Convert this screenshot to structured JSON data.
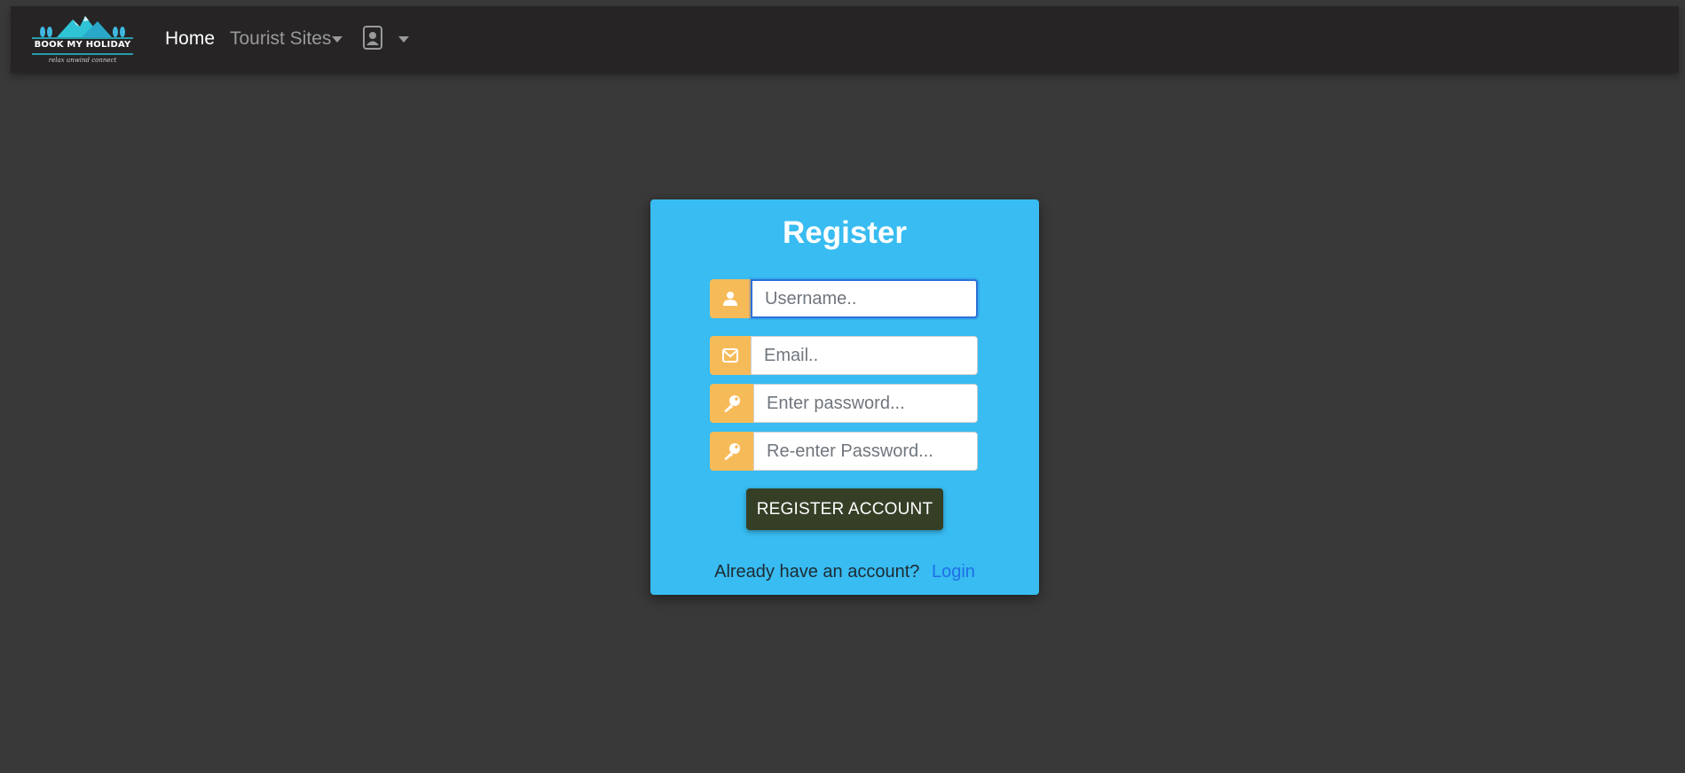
{
  "brand": {
    "logo_title": "BOOK MY HOLIDAY",
    "logo_tagline": "relax unwind connect",
    "colors": {
      "mountains": "#2ec4d6",
      "trees": "#3fb8e0"
    }
  },
  "nav": {
    "home": "Home",
    "tourist_sites": "Tourist Sites",
    "profile_icon": "contact-card-icon"
  },
  "form": {
    "title": "Register",
    "username": {
      "placeholder": "Username..",
      "value": "",
      "icon": "user-icon"
    },
    "email": {
      "placeholder": "Email..",
      "value": "",
      "icon": "envelope-icon"
    },
    "password": {
      "placeholder": "Enter password...",
      "value": "",
      "icon": "key-icon"
    },
    "confirm_password": {
      "placeholder": "Re-enter Password...",
      "value": "",
      "icon": "key-icon"
    },
    "submit_label": "REGISTER ACCOUNT",
    "footer_text": "Already have an account?",
    "login_label": "Login"
  },
  "colors": {
    "page_bg": "#393939",
    "navbar_bg": "#262425",
    "card_bg": "#38bcf1",
    "addon_bg": "#f6bb59",
    "button_bg": "#353f26",
    "link": "#1f6fe8"
  }
}
